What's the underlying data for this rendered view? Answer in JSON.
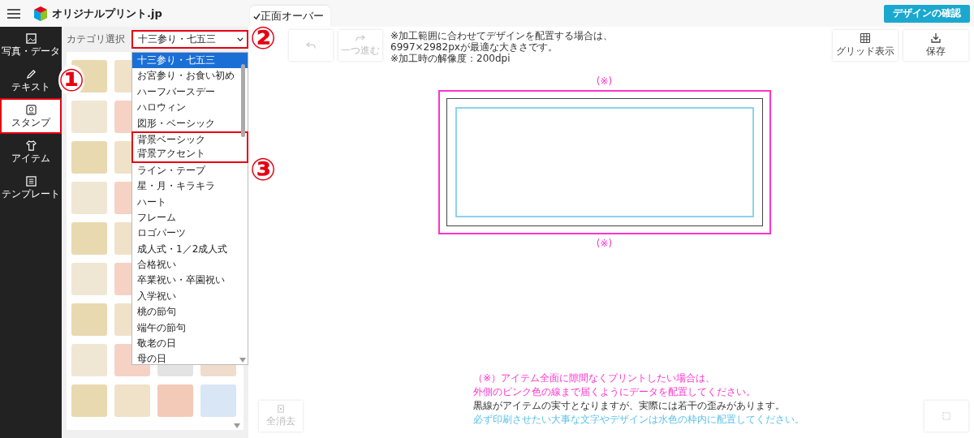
{
  "header": {
    "logo_text": "オリジナルプリント.jp",
    "tab": {
      "label": "正面オーバー",
      "checked": true
    },
    "confirm_button": "デザインの確認"
  },
  "sidebar": {
    "items": [
      {
        "label": "写真・データ",
        "kind": "image",
        "selected": false
      },
      {
        "label": "テキスト",
        "kind": "pen",
        "selected": false
      },
      {
        "label": "スタンプ",
        "kind": "stamp",
        "selected": true
      },
      {
        "label": "アイテム",
        "kind": "shirt",
        "selected": false
      },
      {
        "label": "テンプレート",
        "kind": "list",
        "selected": false
      }
    ]
  },
  "panel": {
    "category_label": "カテゴリ選択",
    "select_value": "十三参り・七五三",
    "options": [
      {
        "label": "十三参り・七五三",
        "selected": true,
        "annotated": false
      },
      {
        "label": "お宮参り・お食い初め",
        "selected": false,
        "annotated": false
      },
      {
        "label": "ハーフバースデー",
        "selected": false,
        "annotated": false
      },
      {
        "label": "ハロウィン",
        "selected": false,
        "annotated": false
      },
      {
        "label": "図形・ベーシック",
        "selected": false,
        "annotated": false
      },
      {
        "label": "背景ベーシック",
        "selected": false,
        "annotated": true
      },
      {
        "label": "背景アクセント",
        "selected": false,
        "annotated": true
      },
      {
        "label": "ライン・テープ",
        "selected": false,
        "annotated": false
      },
      {
        "label": "星・月・キラキラ",
        "selected": false,
        "annotated": false
      },
      {
        "label": "ハート",
        "selected": false,
        "annotated": false
      },
      {
        "label": "フレーム",
        "selected": false,
        "annotated": false
      },
      {
        "label": "ロゴパーツ",
        "selected": false,
        "annotated": false
      },
      {
        "label": "成人式・1／2成人式",
        "selected": false,
        "annotated": false
      },
      {
        "label": "合格祝い",
        "selected": false,
        "annotated": false
      },
      {
        "label": "卒業祝い・卒園祝い",
        "selected": false,
        "annotated": false
      },
      {
        "label": "入学祝い",
        "selected": false,
        "annotated": false
      },
      {
        "label": "桃の節句",
        "selected": false,
        "annotated": false
      },
      {
        "label": "端午の節句",
        "selected": false,
        "annotated": false
      },
      {
        "label": "敬老の日",
        "selected": false,
        "annotated": false
      },
      {
        "label": "母の日",
        "selected": false,
        "annotated": false
      }
    ]
  },
  "toolbar": {
    "redo_label": "一つ進む",
    "note": [
      "※加工範囲に合わせてデザインを配置する場合は、",
      "6997×2982pxが最適な大きさです。",
      "※加工時の解像度：200dpi"
    ],
    "grid_label": "グリッド表示",
    "save_label": "保存"
  },
  "canvas": {
    "top_mark": "(※)",
    "bottom_mark": "(※)"
  },
  "notes": [
    {
      "text": "（※）アイテム全面に隙間なくプリントしたい場合は、",
      "color": "#ff33cc"
    },
    {
      "text": "外側のピンク色の線まで届くようにデータを配置してください。",
      "color": "#ff33cc"
    },
    {
      "text": "黒線がアイテムの実寸となりますが、実際には若干の歪みがあります。",
      "color": "#333333"
    },
    {
      "text": "必ず印刷させたい大事な文字やデザインは水色の枠内に配置してください。",
      "color": "#5bc0eb"
    }
  ],
  "clear_button": "全消去",
  "callouts": [
    "①",
    "②",
    "③"
  ]
}
